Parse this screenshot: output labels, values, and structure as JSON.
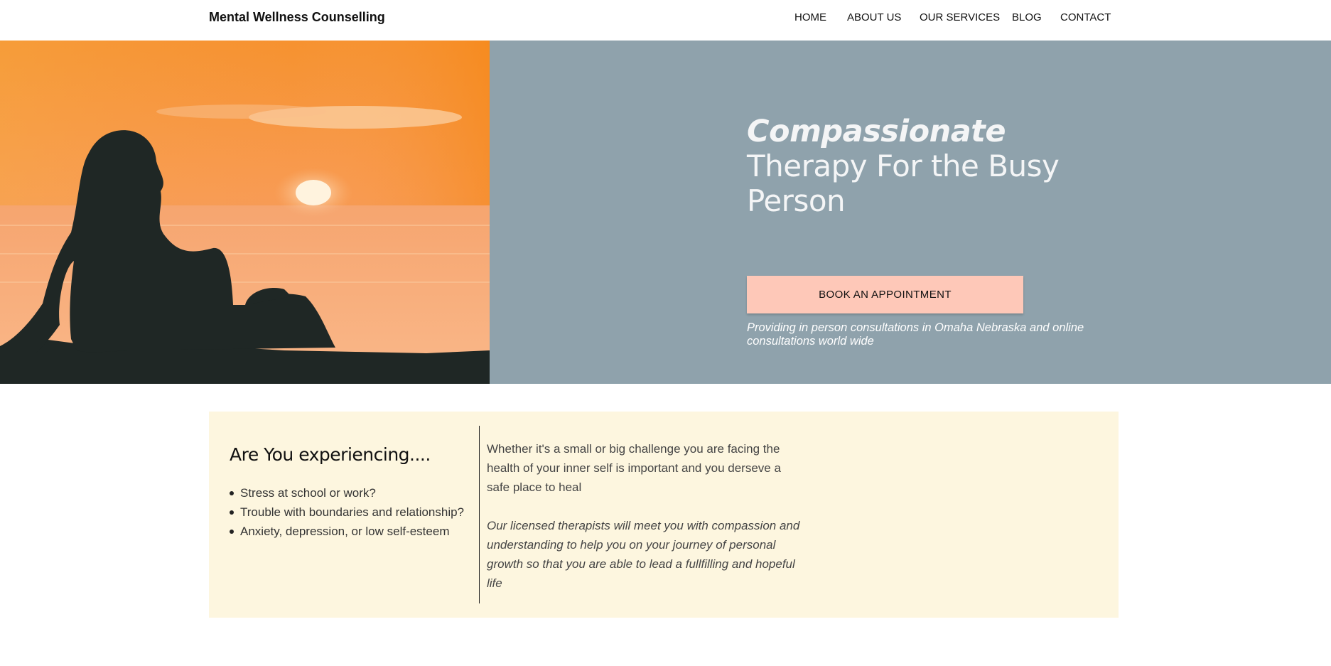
{
  "header": {
    "brand": "Mental Wellness Counselling",
    "nav": [
      "HOME",
      "ABOUT US",
      "OUR SERVICES",
      "BLOG",
      "CONTACT"
    ]
  },
  "hero": {
    "title_italic": "Compassionate",
    "title_rest": "Therapy For the Busy Person",
    "button_label": "BOOK AN APPOINTMENT",
    "note": "Providing in person consultations in Omaha Nebraska and online consultations world wide",
    "image_subject": "silhouette of woman sitting by the sea at sunset"
  },
  "info": {
    "heading": "Are You experiencing....",
    "list": [
      "Stress at school or work?",
      "Trouble with boundaries and relationship?",
      "Anxiety, depression, or low self-esteem"
    ],
    "paragraph1": "Whether it's a small or big challenge you are facing the health of your inner self is important and you derseve a safe place to heal",
    "paragraph2": "Our licensed therapists will meet you with compassion and understanding to help you on your journey of personal growth so that you are able to lead a fullfilling and hopeful life"
  },
  "colors": {
    "hero_bg": "#8fa2ac",
    "button_bg": "#fec8b8",
    "info_bg": "#fdf6df",
    "sunset_orange": "#f6923a",
    "silhouette": "#1f2725"
  }
}
